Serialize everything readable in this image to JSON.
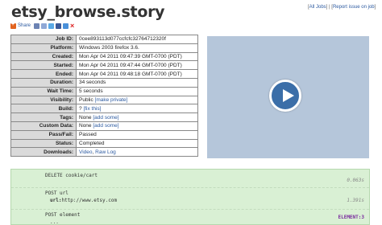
{
  "page": {
    "title": "etsy_browse.story",
    "links": {
      "all_jobs": "All Jobs",
      "separator": "|",
      "report": "Report issue on job"
    },
    "share": {
      "label": "Share"
    }
  },
  "job": {
    "rows": [
      {
        "key": "Job ID:",
        "value": "0cee893113d077ccfcfc32764712320f"
      },
      {
        "key": "Platform:",
        "value": "Windows 2003 firefox 3.6."
      },
      {
        "key": "Created:",
        "value": "Mon Apr 04 2011 09:47:39 GMT-0700 (PDT)"
      },
      {
        "key": "Started:",
        "value": "Mon Apr 04 2011 09:47:44 GMT-0700 (PDT)"
      },
      {
        "key": "Ended:",
        "value": "Mon Apr 04 2011 09:48:18 GMT-0700 (PDT)"
      },
      {
        "key": "Duration:",
        "value": "34 seconds"
      },
      {
        "key": "Wait Time:",
        "value": "5 seconds"
      },
      {
        "key": "Visibility:",
        "value": "Public",
        "link": "[make private]"
      },
      {
        "key": "Build:",
        "value": "?",
        "link": "[fix this]"
      },
      {
        "key": "Tags:",
        "value": "None",
        "link": "[add some]"
      },
      {
        "key": "Custom Data:",
        "value": "None",
        "link": "[add some]"
      },
      {
        "key": "Pass/Fail:",
        "value": "Passed"
      },
      {
        "key": "Status:",
        "value": "Completed"
      },
      {
        "key": "Downloads:",
        "link1": "Video",
        "link2": "Raw Log"
      }
    ]
  },
  "log": {
    "steps": [
      {
        "command": "DELETE cookie/cart",
        "time": "0.063s"
      },
      {
        "command": "POST url",
        "arg_key": "url:",
        "arg_value": "http://www.etsy.com",
        "time": "1.391s"
      },
      {
        "command": "POST element",
        "arg_value": "...",
        "tag": "ELEMENT:3"
      }
    ]
  },
  "colors": {
    "table_key_bg": "#dadada",
    "video_bg": "#b5c6da",
    "play_button": "#3b6ea8",
    "log_bg": "#d9f0d4",
    "link": "#2c5aa0"
  }
}
